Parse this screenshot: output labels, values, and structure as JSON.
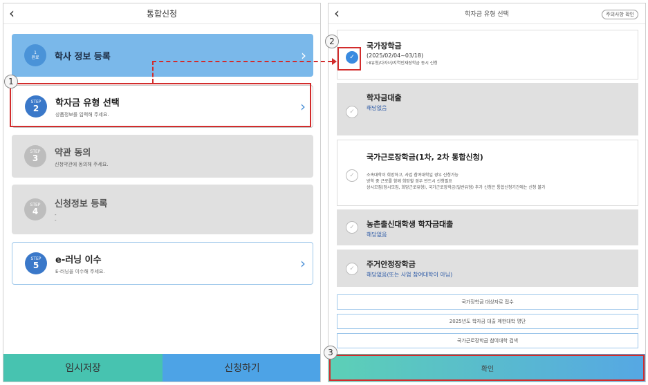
{
  "left": {
    "title": "통합신청",
    "steps": [
      {
        "badge_small": "1",
        "badge_num": "완료",
        "title": "학사 정보 등록",
        "subtitle": ""
      },
      {
        "badge_small": "STEP",
        "badge_num": "2",
        "title": "학자금 유형 선택",
        "subtitle": "상품정보를 입력해 주세요."
      },
      {
        "badge_small": "STEP",
        "badge_num": "3",
        "title": "약관 동의",
        "subtitle": "신청약관에 동의해 주세요."
      },
      {
        "badge_small": "STEP",
        "badge_num": "4",
        "title": "신청정보 등록",
        "subtitle": "-\n-"
      },
      {
        "badge_small": "STEP",
        "badge_num": "5",
        "title": "e-러닝 이수",
        "subtitle": "E-러닝을 이수해 주세요."
      }
    ],
    "temp_save": "임시저장",
    "apply": "신청하기"
  },
  "right": {
    "title": "학자금 유형 선택",
    "top_button": "주의사항 확인",
    "options": [
      {
        "title": "국가장학금",
        "sub": "(2025/02/04~03/18)",
        "desc": "Ⅰ·Ⅱ유형/다자녀/지역인재장학금 동시 신청"
      },
      {
        "title": "학자금대출",
        "sub": "해당없음",
        "desc": ""
      },
      {
        "title": "국가근로장학금(1차, 2차 통합신청)",
        "sub": "",
        "desc": "소속대학이 희망하고, 사업 참여대학일 경우 신청가능\n방학 중 근로를 함께 희망할 경우 반드시 신청필요\n상시모집(정시모집, 희망근로유형), 국가근로장학금(일반유형) 추가 신청은 통합신청기간에는 신청 불가"
      },
      {
        "title": "농촌출신대학생 학자금대출",
        "sub": "해당없음",
        "desc": ""
      },
      {
        "title": "주거안정장학금",
        "sub": "해당없음(또는 사업 참여대학이 아님)",
        "desc": ""
      }
    ],
    "links": [
      "국가장학금 대상자로 접수",
      "2025년도 학자금 대출 제한대학 명단",
      "국가근로장학금 참여대학 검색"
    ],
    "confirm": "확인"
  },
  "callouts": [
    "1",
    "2",
    "3"
  ],
  "colors": {
    "completed_card": "#7ab8ea",
    "active_border": "#d22c2c",
    "step_badge": "#3a78c9",
    "inactive_card": "#e0e0e0"
  }
}
